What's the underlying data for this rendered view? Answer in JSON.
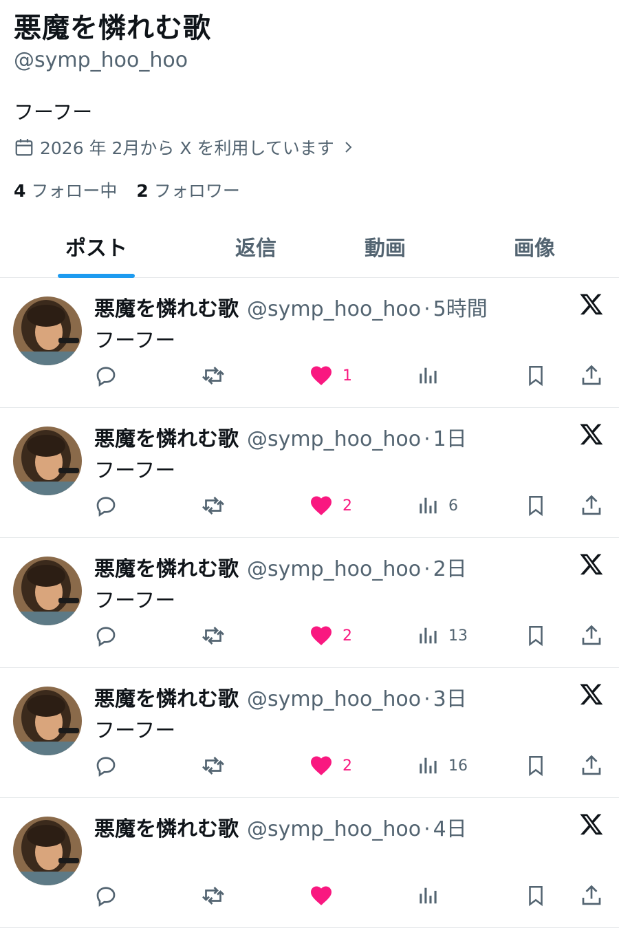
{
  "profile": {
    "display_name": "悪魔を憐れむ歌",
    "handle": "@symp_hoo_hoo",
    "bio": "フーフー",
    "joined": "2026 年 2月から X を利用しています",
    "following_count": "4",
    "following_label": "フォロー中",
    "followers_count": "2",
    "followers_label": "フォロワー"
  },
  "tabs": [
    {
      "label": "ポスト",
      "active": true
    },
    {
      "label": "返信"
    },
    {
      "label": "動画"
    },
    {
      "label": "画像"
    }
  ],
  "posts": [
    {
      "name": "悪魔を憐れむ歌",
      "handle": "@symp_hoo_hoo",
      "dot": "·",
      "time": "5時間",
      "body": "フーフー",
      "likes": "1",
      "views": ""
    },
    {
      "name": "悪魔を憐れむ歌",
      "handle": "@symp_hoo_hoo",
      "dot": "·",
      "time": "1日",
      "body": "フーフー",
      "likes": "2",
      "views": "6"
    },
    {
      "name": "悪魔を憐れむ歌",
      "handle": "@symp_hoo_hoo",
      "dot": "·",
      "time": "2日",
      "body": "フーフー",
      "likes": "2",
      "views": "13"
    },
    {
      "name": "悪魔を憐れむ歌",
      "handle": "@symp_hoo_hoo",
      "dot": "·",
      "time": "3日",
      "body": "フーフー",
      "likes": "2",
      "views": "16"
    },
    {
      "name": "悪魔を憐れむ歌",
      "handle": "@symp_hoo_hoo",
      "dot": "·",
      "time": "4日",
      "body": "",
      "likes": "",
      "views": ""
    }
  ],
  "colors": {
    "accent": "#1d9bf0",
    "like": "#f91880",
    "muted": "#536471"
  },
  "icons": [
    "calendar-icon",
    "chevron-right-icon",
    "reply-icon",
    "repost-icon",
    "heart-icon",
    "views-icon",
    "bookmark-icon",
    "share-icon",
    "x-logo-icon"
  ]
}
